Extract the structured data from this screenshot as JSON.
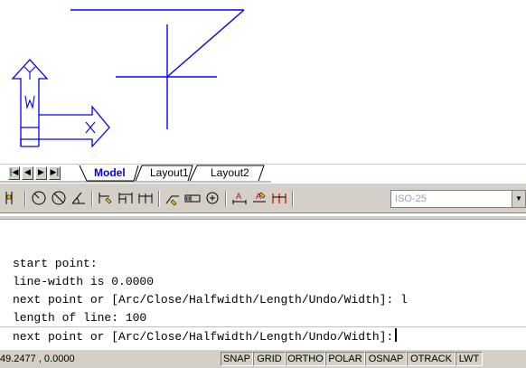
{
  "layout_tabs": {
    "nav_first": "|◀",
    "nav_prev": "◀",
    "nav_next": "▶",
    "nav_last": "▶|",
    "model": "Model",
    "layout1": "Layout1",
    "layout2": "Layout2"
  },
  "toolbar": {
    "dimstyle_value": "ISO-25",
    "dimstyle_arrow": "▼"
  },
  "ucs_icon": {
    "y_label": "Y",
    "w_label": "W",
    "x_label": "X"
  },
  "command_history": [
    "start point:",
    "line-width is 0.0000",
    "next point or [Arc/Close/Halfwidth/Length/Undo/Width]: l",
    "length of line: 100"
  ],
  "command_prompt": "next point or [Arc/Close/Halfwidth/Length/Undo/Width]:",
  "status_bar": {
    "coordinates": "49.2477 , 0.0000",
    "snap": "SNAP",
    "grid": "GRID",
    "ortho": "ORTHO",
    "polar": "POLAR",
    "osnap": "OSNAP",
    "otrack": "OTRACK",
    "lwt": "LWT"
  },
  "colors": {
    "drawing_line": "#0000ff",
    "ucs_icon": "#0000ff",
    "active_tab": "#0000ee",
    "chrome": "#d4d0c8"
  }
}
